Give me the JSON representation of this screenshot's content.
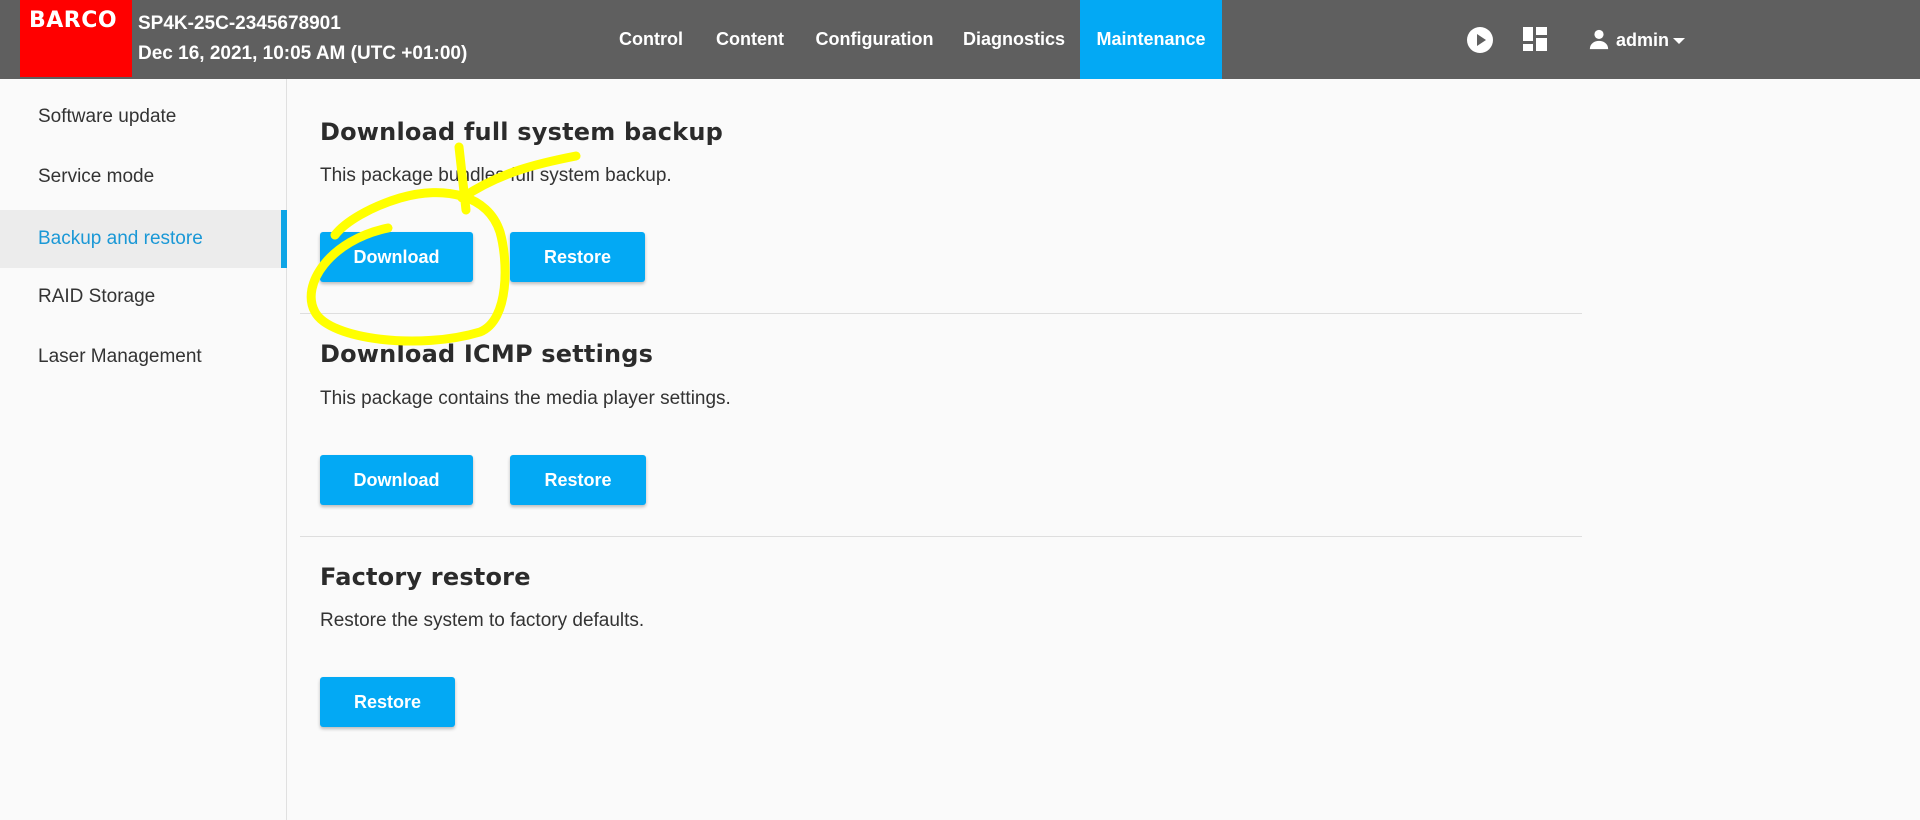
{
  "header": {
    "logo_text": "BARCO",
    "device_name": "SP4K-25C-2345678901",
    "datetime": "Dec 16, 2021, 10:05 AM (UTC +01:00)",
    "nav": [
      {
        "label": "Control"
      },
      {
        "label": "Content"
      },
      {
        "label": "Configuration"
      },
      {
        "label": "Diagnostics"
      },
      {
        "label": "Maintenance",
        "active": true
      }
    ],
    "icons": [
      "play-icon",
      "dashboard-icon"
    ],
    "user": {
      "label": "admin",
      "icon": "person-icon",
      "caret": "caret-down-icon"
    }
  },
  "sidebar": {
    "items": [
      {
        "label": "Software update"
      },
      {
        "label": "Service mode"
      },
      {
        "label": "Backup and restore",
        "active": true
      },
      {
        "label": "RAID Storage"
      },
      {
        "label": "Laser Management"
      }
    ]
  },
  "sections": [
    {
      "title": "Download full system backup",
      "description": "This package bundles full system backup.",
      "buttons": [
        "Download",
        "Restore"
      ]
    },
    {
      "title": "Download ICMP settings",
      "description": "This package contains the media player settings.",
      "buttons": [
        "Download",
        "Restore"
      ]
    },
    {
      "title": "Factory restore",
      "description": "Restore the system to factory defaults.",
      "buttons": [
        "Restore"
      ]
    }
  ],
  "colors": {
    "header_bg": "#5f5f5f",
    "logo_bg": "#ff0000",
    "accent": "#03a9f4",
    "sidebar_active_text": "#1a98d6",
    "annotation": "#ffff00"
  }
}
